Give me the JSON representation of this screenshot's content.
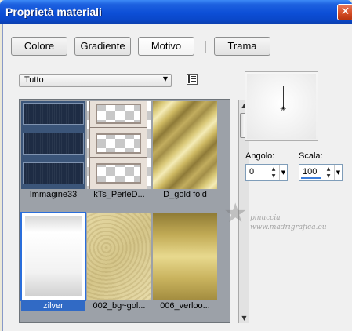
{
  "window": {
    "title": "Proprietà materiali",
    "close_glyph": "✕"
  },
  "tabs": [
    {
      "label": "Colore",
      "active": false
    },
    {
      "label": "Gradiente",
      "active": false
    },
    {
      "label": "Motivo",
      "active": true
    },
    {
      "label": "Trama",
      "active": false
    }
  ],
  "category_select": {
    "value": "Tutto",
    "arrow": "▼"
  },
  "view_toggle": {
    "icon": "list-view-icon"
  },
  "patterns": [
    {
      "label": "Immagine33",
      "selected": false
    },
    {
      "label": "kTs_PerleD...",
      "selected": false
    },
    {
      "label": "D_gold fold",
      "selected": false
    },
    {
      "label": "zilver",
      "selected": true
    },
    {
      "label": "002_bg~gol...",
      "selected": false
    },
    {
      "label": "006_verloo...",
      "selected": false
    }
  ],
  "scrollbar": {
    "up": "▲",
    "down": "▼"
  },
  "preview": {
    "marker": "✳"
  },
  "angle": {
    "label": "Angolo:",
    "value": "0"
  },
  "scale": {
    "label": "Scala:",
    "value": "100"
  },
  "spinner": {
    "up": "▲",
    "down": "▼",
    "drop": "▼"
  },
  "watermark": {
    "line1": "pinuccia",
    "line2": "www.madrigrafica.eu",
    "icon": "star-icon"
  },
  "colors": {
    "title_bar": "#0D4FD7",
    "selection": "#316AC5",
    "panel": "#F0F0F0"
  }
}
